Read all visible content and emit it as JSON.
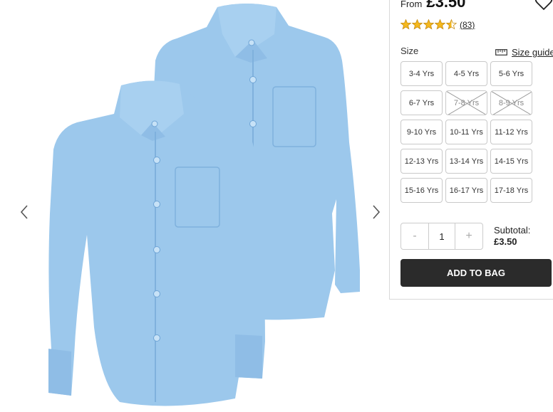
{
  "gallery": {
    "image_alt": "Blue school shirts",
    "prev_icon": "chevron-left-icon",
    "next_icon": "chevron-right-icon"
  },
  "product": {
    "price_prefix": "From",
    "price": "£3.50",
    "wishlist_icon": "heart-icon",
    "rating": 4.5,
    "rating_max": 5,
    "review_count": "(83)",
    "star_color": "#f5b81c"
  },
  "size_selector": {
    "label": "Size",
    "guide_icon": "ruler-icon",
    "guide_label": "Size guide",
    "options": [
      {
        "label": "3-4 Yrs",
        "available": true
      },
      {
        "label": "4-5 Yrs",
        "available": true
      },
      {
        "label": "5-6 Yrs",
        "available": true
      },
      {
        "label": "6-7 Yrs",
        "available": true
      },
      {
        "label": "7-8 Yrs",
        "available": false
      },
      {
        "label": "8-9 Yrs",
        "available": false
      },
      {
        "label": "9-10 Yrs",
        "available": true
      },
      {
        "label": "10-11 Yrs",
        "available": true
      },
      {
        "label": "11-12 Yrs",
        "available": true
      },
      {
        "label": "12-13 Yrs",
        "available": true
      },
      {
        "label": "13-14 Yrs",
        "available": true
      },
      {
        "label": "14-15 Yrs",
        "available": true
      },
      {
        "label": "15-16 Yrs",
        "available": true
      },
      {
        "label": "16-17 Yrs",
        "available": true
      },
      {
        "label": "17-18 Yrs",
        "available": true
      }
    ]
  },
  "quantity": {
    "minus": "-",
    "value": "1",
    "plus": "+"
  },
  "subtotal": {
    "label": "Subtotal:",
    "value": "£3.50"
  },
  "cta": {
    "label": "ADD TO BAG",
    "color": "#2b2b2b"
  },
  "colors": {
    "shirt": "#9cc8ec",
    "shirt_shadow": "#7fb1dd",
    "border": "#c9c9c9"
  }
}
